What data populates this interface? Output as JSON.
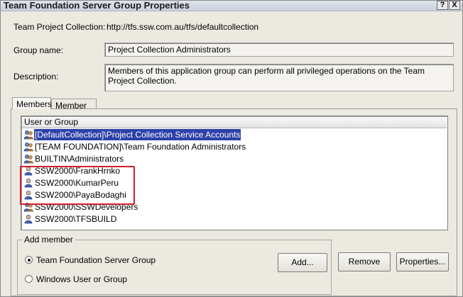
{
  "window": {
    "title": "Team Foundation Server Group Properties"
  },
  "titlebar_buttons": {
    "help": "?",
    "close": "X"
  },
  "form": {
    "collection_label": "Team Project Collection:",
    "collection_value": "http://tfs.ssw.com.au/tfs/defaultcollection",
    "group_name_label": "Group name:",
    "group_name_value": "Project Collection Administrators",
    "description_label": "Description:",
    "description_value": "Members of this application group can perform all privileged operations on the Team Project Collection."
  },
  "tabs": [
    {
      "label": "Members",
      "active": true
    },
    {
      "label": "Member of",
      "active": false
    }
  ],
  "members_list": {
    "column_header": "User or Group",
    "rows": [
      {
        "label": "[DefaultCollection]\\Project Collection Service Accounts",
        "icon": "group-icon",
        "selected": true
      },
      {
        "label": "[TEAM FOUNDATION]\\Team Foundation Administrators",
        "icon": "group-icon",
        "selected": false
      },
      {
        "label": "BUILTIN\\Administrators",
        "icon": "group-icon",
        "selected": false
      },
      {
        "label": "SSW2000\\FrankHrnko",
        "icon": "user-icon",
        "selected": false
      },
      {
        "label": "SSW2000\\KumarPeru",
        "icon": "user-icon",
        "selected": false
      },
      {
        "label": "SSW2000\\PayaBodaghi",
        "icon": "user-icon",
        "selected": false
      },
      {
        "label": "SSW2000\\SSWDevelopers",
        "icon": "group-icon",
        "selected": false
      },
      {
        "label": "SSW2000\\TFSBUILD",
        "icon": "user-icon",
        "selected": false
      }
    ]
  },
  "add_member": {
    "legend": "Add member",
    "options": [
      {
        "label": "Team Foundation Server Group",
        "checked": true
      },
      {
        "label": "Windows User or Group",
        "checked": false
      }
    ],
    "add_button": "Add..."
  },
  "buttons": {
    "remove": "Remove",
    "properties": "Properties..."
  },
  "colors": {
    "selection": "#2c41a8",
    "highlight_box": "#cf1f2a",
    "dialog_bg": "#ece9e1"
  }
}
